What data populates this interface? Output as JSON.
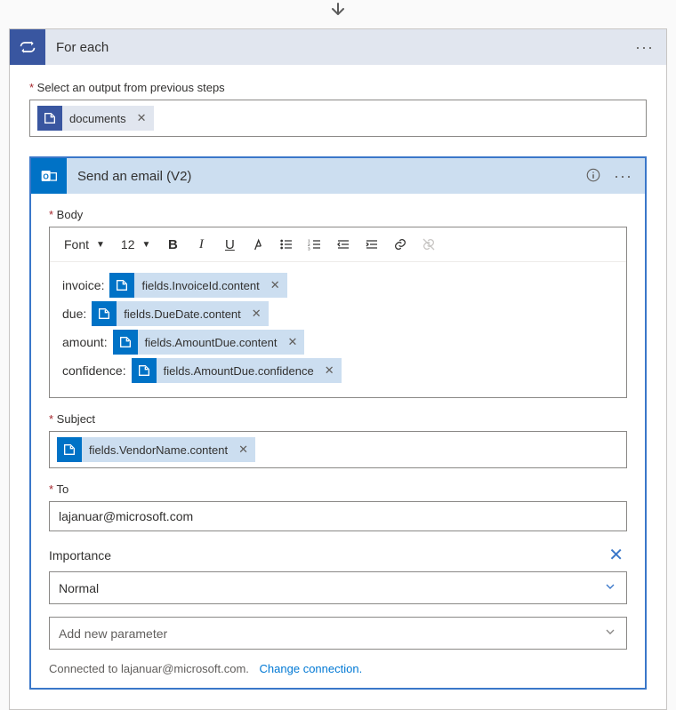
{
  "foreach": {
    "title": "For each",
    "output_label": "Select an output from previous steps",
    "output_token": "documents"
  },
  "email": {
    "title": "Send an email (V2)",
    "body_label": "Body",
    "font_label": "Font",
    "font_size": "12",
    "body_lines": {
      "l0_label": "invoice:",
      "l0_token": "fields.InvoiceId.content",
      "l1_label": "due:",
      "l1_token": "fields.DueDate.content",
      "l2_label": "amount:",
      "l2_token": "fields.AmountDue.content",
      "l3_label": "confidence:",
      "l3_token": "fields.AmountDue.confidence"
    },
    "subject_label": "Subject",
    "subject_token": "fields.VendorName.content",
    "to_label": "To",
    "to_value": "lajanuar@microsoft.com",
    "importance_label": "Importance",
    "importance_value": "Normal",
    "add_param": "Add new parameter",
    "connected_text": "Connected to lajanuar@microsoft.com.",
    "change_conn": "Change connection."
  }
}
